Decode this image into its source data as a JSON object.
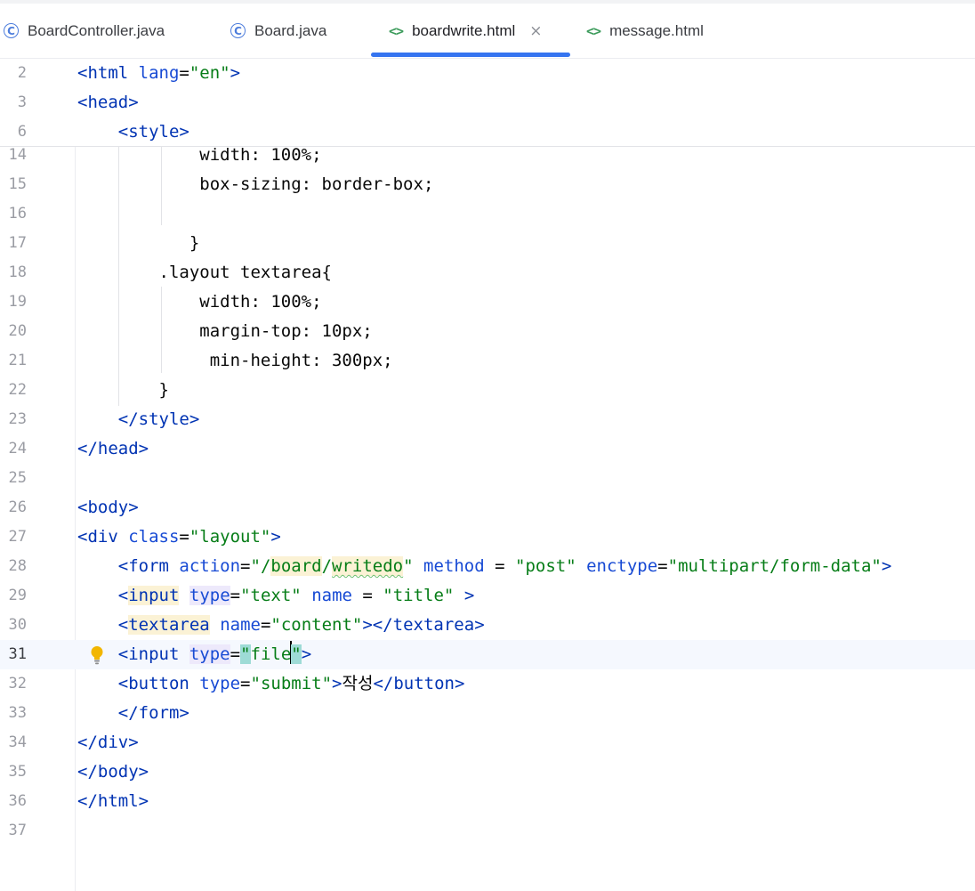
{
  "tabs": [
    {
      "label": "BoardController.java",
      "icon": "class-icon"
    },
    {
      "label": "Board.java",
      "icon": "class-icon"
    },
    {
      "label": "boardwrite.html",
      "icon": "html-icon",
      "active": true
    },
    {
      "label": "message.html",
      "icon": "html-icon"
    }
  ],
  "close_glyph": "×",
  "sticky_lines": [
    {
      "number": "2",
      "parts": [
        [
          "tag",
          "<html "
        ],
        [
          "attr",
          "lang"
        ],
        [
          "txt",
          "="
        ],
        [
          "val",
          "\"en\""
        ],
        [
          "tag",
          ">"
        ]
      ]
    },
    {
      "number": "3",
      "parts": [
        [
          "tag",
          "<head>"
        ]
      ]
    },
    {
      "number": "6",
      "parts": [
        [
          "tag",
          "<style>"
        ]
      ]
    }
  ],
  "lines": [
    {
      "number": "14",
      "indent": "            ",
      "parts": [
        [
          "css",
          "width: 100%;"
        ]
      ]
    },
    {
      "number": "15",
      "indent": "            ",
      "parts": [
        [
          "css",
          "box-sizing: border-box;"
        ]
      ]
    },
    {
      "number": "16",
      "indent": "",
      "parts": []
    },
    {
      "number": "17",
      "indent": "           ",
      "parts": [
        [
          "css",
          "}"
        ]
      ]
    },
    {
      "number": "18",
      "indent": "        ",
      "parts": [
        [
          "css",
          ".layout textarea{"
        ]
      ]
    },
    {
      "number": "19",
      "indent": "            ",
      "parts": [
        [
          "css",
          "width: 100%;"
        ]
      ]
    },
    {
      "number": "20",
      "indent": "            ",
      "parts": [
        [
          "css",
          "margin-top: 10px;"
        ]
      ]
    },
    {
      "number": "21",
      "indent": "             ",
      "parts": [
        [
          "css",
          "min-height: 300px;"
        ]
      ]
    },
    {
      "number": "22",
      "indent": "        ",
      "parts": [
        [
          "css",
          "}"
        ]
      ]
    },
    {
      "number": "23",
      "indent": "    ",
      "parts": [
        [
          "tag",
          "</style>"
        ]
      ]
    },
    {
      "number": "24",
      "indent": "",
      "parts": [
        [
          "tag",
          "</head>"
        ]
      ]
    },
    {
      "number": "25",
      "indent": "",
      "parts": []
    },
    {
      "number": "26",
      "indent": "",
      "parts": [
        [
          "tag",
          "<body>"
        ]
      ]
    },
    {
      "number": "27",
      "indent": "",
      "parts": [
        [
          "tag",
          "<div "
        ],
        [
          "attr",
          "class"
        ],
        [
          "txt",
          "="
        ],
        [
          "val",
          "\"layout\""
        ],
        [
          "tag",
          ">"
        ]
      ]
    },
    {
      "number": "28",
      "indent": "    ",
      "parts": [
        [
          "tag",
          "<form "
        ],
        [
          "attr",
          "action"
        ],
        [
          "txt",
          "="
        ],
        [
          "val",
          "\"/"
        ],
        [
          "val hl-y",
          "board"
        ],
        [
          "val",
          "/"
        ],
        [
          "val hl-y squig-g",
          "writedo"
        ],
        [
          "val",
          "\""
        ],
        [
          "txt",
          " "
        ],
        [
          "attr",
          "method"
        ],
        [
          "txt",
          " = "
        ],
        [
          "val",
          "\"post\""
        ],
        [
          "txt",
          " "
        ],
        [
          "attr",
          "enctype"
        ],
        [
          "txt",
          "="
        ],
        [
          "val",
          "\"multipart/form-data\""
        ],
        [
          "tag",
          ">"
        ]
      ]
    },
    {
      "number": "29",
      "indent": "    ",
      "parts": [
        [
          "tag",
          "<"
        ],
        [
          "tag hl-y",
          "input"
        ],
        [
          "txt",
          " "
        ],
        [
          "attr hl-p",
          "type"
        ],
        [
          "txt",
          "="
        ],
        [
          "val",
          "\"text\""
        ],
        [
          "txt",
          " "
        ],
        [
          "attr",
          "name"
        ],
        [
          "txt",
          " = "
        ],
        [
          "val",
          "\"title\""
        ],
        [
          "txt",
          " "
        ],
        [
          "tag",
          ">"
        ]
      ]
    },
    {
      "number": "30",
      "indent": "    ",
      "parts": [
        [
          "tag",
          "<"
        ],
        [
          "tag hl-y",
          "textarea"
        ],
        [
          "txt",
          " "
        ],
        [
          "attr",
          "name"
        ],
        [
          "txt",
          "="
        ],
        [
          "val",
          "\"content\""
        ],
        [
          "tag",
          "></textarea>"
        ]
      ]
    },
    {
      "number": "31",
      "indent": "    ",
      "current": true,
      "parts": [
        [
          "tag",
          "<input "
        ],
        [
          "attr hl-p",
          "type"
        ],
        [
          "txt",
          "="
        ],
        [
          "val hl-t",
          "\""
        ],
        [
          "val",
          "file"
        ],
        [
          "caret",
          ""
        ],
        [
          "val hl-t",
          "\""
        ],
        [
          "tag",
          ">"
        ]
      ]
    },
    {
      "number": "32",
      "indent": "    ",
      "parts": [
        [
          "tag",
          "<button "
        ],
        [
          "attr",
          "type"
        ],
        [
          "txt",
          "="
        ],
        [
          "val",
          "\"submit\""
        ],
        [
          "tag",
          ">"
        ],
        [
          "txt",
          "작성"
        ],
        [
          "tag",
          "</button>"
        ]
      ]
    },
    {
      "number": "33",
      "indent": "    ",
      "parts": [
        [
          "tag",
          "</form>"
        ]
      ]
    },
    {
      "number": "34",
      "indent": "",
      "parts": [
        [
          "tag",
          "</div>"
        ]
      ]
    },
    {
      "number": "35",
      "indent": "",
      "parts": [
        [
          "tag",
          "</body>"
        ]
      ]
    },
    {
      "number": "36",
      "indent": "",
      "parts": [
        [
          "tag",
          "</html>"
        ]
      ]
    },
    {
      "number": "37",
      "indent": "",
      "parts": []
    }
  ],
  "colors": {
    "accent": "#3574f0",
    "tag": "#0033b3",
    "attribute": "#174ad4",
    "string": "#067d17"
  }
}
